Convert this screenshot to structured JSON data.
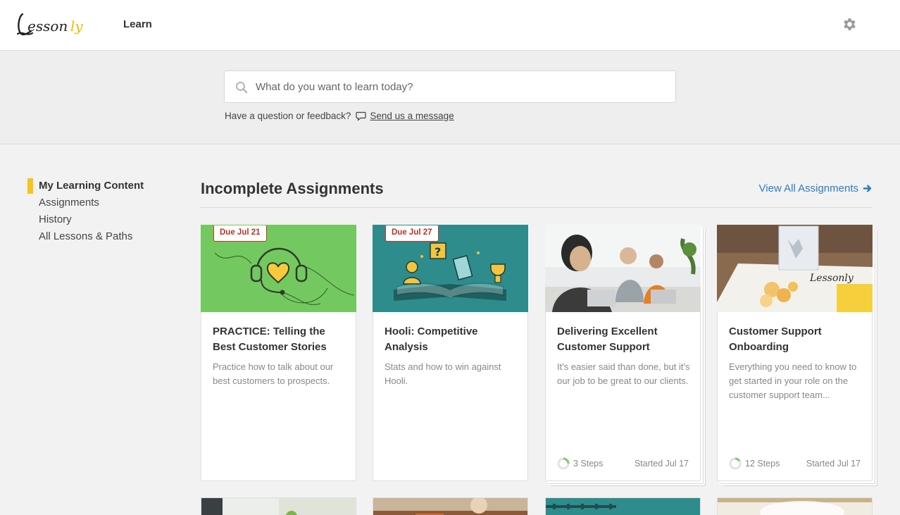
{
  "header": {
    "logo_text": "Lessonly",
    "nav_learn": "Learn"
  },
  "search": {
    "placeholder": "What do you want to learn today?",
    "value": ""
  },
  "feedback": {
    "prompt": "Have a question or feedback?",
    "link": "Send us a message"
  },
  "sidebar": {
    "items": [
      {
        "label": "My Learning Content",
        "active": true
      },
      {
        "label": "Assignments",
        "active": false
      },
      {
        "label": "History",
        "active": false
      },
      {
        "label": "All Lessons & Paths",
        "active": false
      }
    ]
  },
  "main": {
    "section_title": "Incomplete Assignments",
    "view_all": "View All Assignments",
    "cards": [
      {
        "due": "Due Jul 21",
        "title": "PRACTICE: Telling the Best Customer Stories",
        "description": "Practice how to talk about our best customers to prospects.",
        "image": "headset-heart-illustration"
      },
      {
        "due": "Due Jul 27",
        "title": "Hooli: Competitive Analysis",
        "description": "Stats and how to win against Hooli.",
        "image": "book-trophy-illustration"
      },
      {
        "title": "Delivering Excellent Customer Support",
        "description": "It's easier said than done, but it's our job to be great to our clients.",
        "steps": "3 Steps",
        "started": "Started Jul 17",
        "image": "support-team-photo"
      },
      {
        "title": "Customer Support Onboarding",
        "description": "Everything you need to know to get started in your role on the customer support team...",
        "steps": "12 Steps",
        "started": "Started Jul 17",
        "image": "welcome-box-photo"
      }
    ]
  },
  "colors": {
    "accent_yellow": "#f5c518",
    "link_blue": "#2d7cc2",
    "due_red": "#b83226",
    "progress_green": "#7bc96f"
  }
}
